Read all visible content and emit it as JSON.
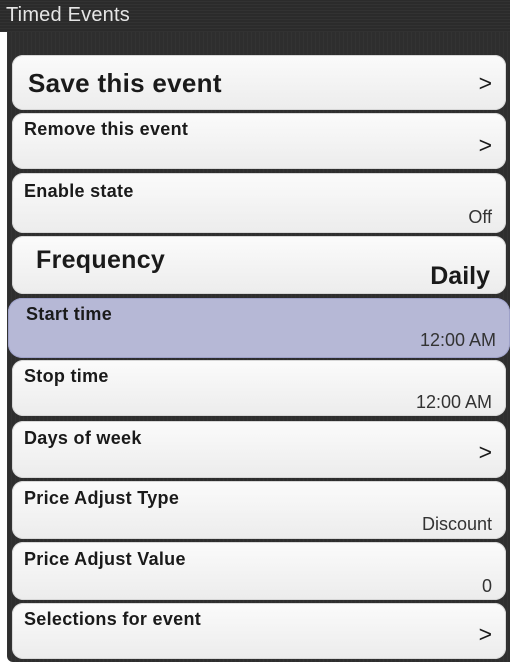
{
  "header": {
    "title": "Timed Events"
  },
  "menu": {
    "save_event": {
      "label": "Save this event",
      "chevron": ">"
    },
    "remove_event": {
      "label": "Remove this event",
      "chevron": ">"
    },
    "enable_state": {
      "label": "Enable state",
      "value": "Off"
    },
    "frequency": {
      "label": "Frequency",
      "value": "Daily"
    },
    "start_time": {
      "label": "Start time",
      "value": "12:00 AM",
      "selected": true
    },
    "stop_time": {
      "label": "Stop time",
      "value": "12:00 AM"
    },
    "days_of_week": {
      "label": "Days of week",
      "chevron": ">"
    },
    "price_adjust_type": {
      "label": "Price Adjust Type",
      "value": "Discount"
    },
    "price_adjust_value": {
      "label": "Price Adjust Value",
      "value": "0"
    },
    "selections_for_event": {
      "label": "Selections for event",
      "chevron": ">"
    }
  },
  "colors": {
    "title_bar": "#2b2b2b",
    "row_background": "#f5f5f5",
    "selected_row": "#b6b8d6"
  }
}
